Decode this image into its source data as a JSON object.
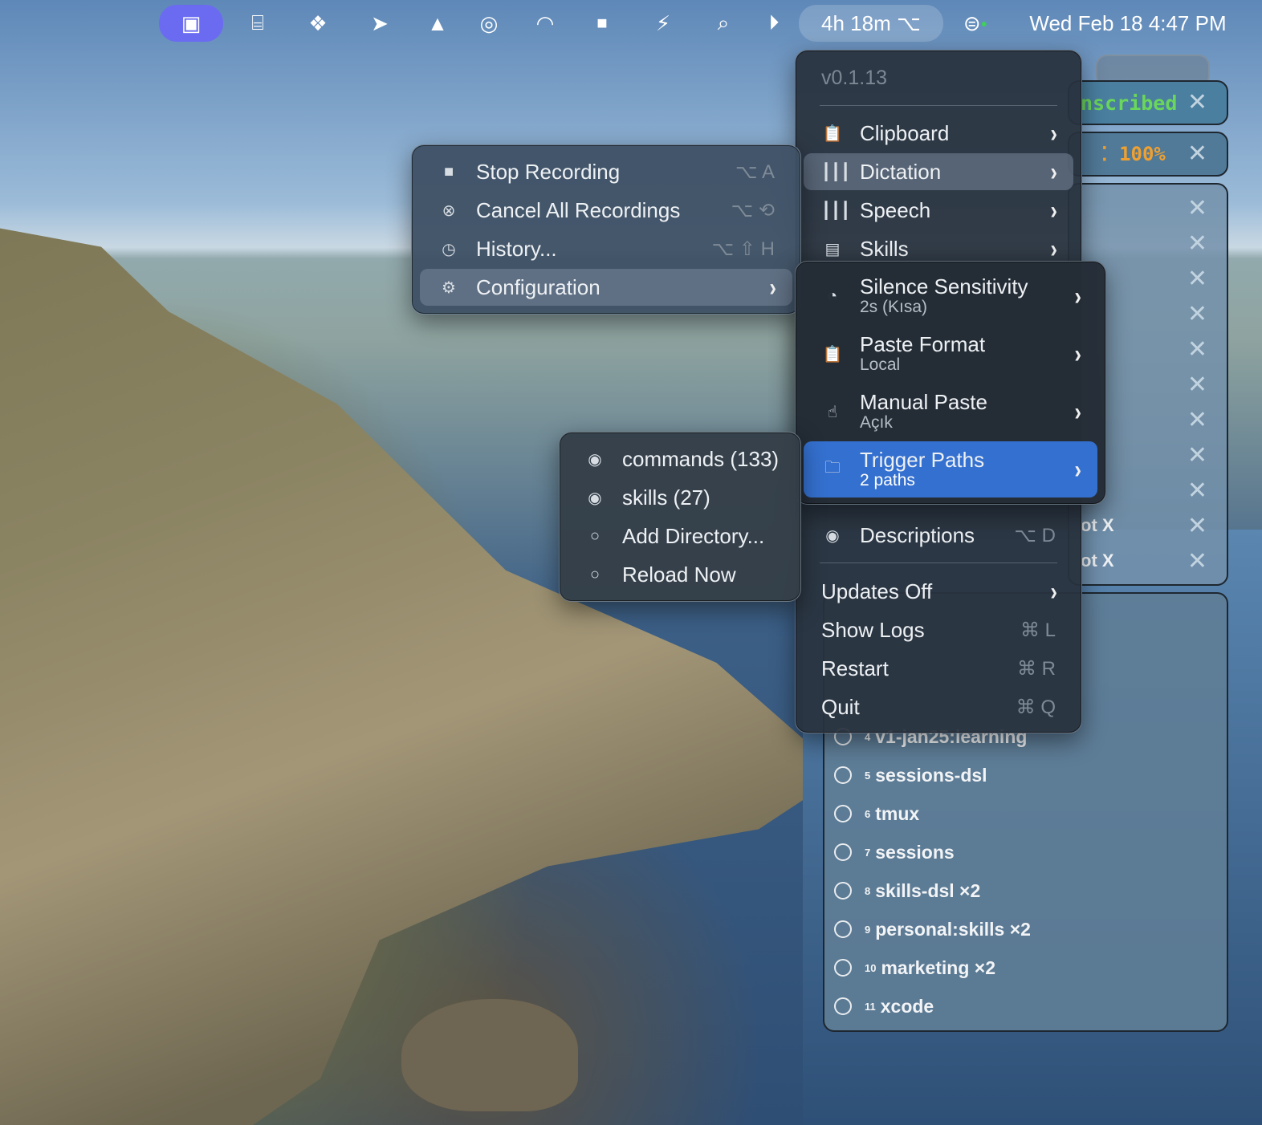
{
  "menubar": {
    "battery_time": "4h 18m",
    "datetime": "Wed Feb 18  4:47 PM",
    "icons": [
      "screen-share-icon",
      "presentation-icon",
      "diamond-grid-icon",
      "location-arrow-icon",
      "drive-icon",
      "onepassword-icon",
      "wifi-icon",
      "stop-record-icon",
      "battery-charging-icon",
      "search-icon",
      "play-icon",
      "option-key-icon",
      "control-center-icon"
    ],
    "accent": "#6b6bf2"
  },
  "main_menu": {
    "version": "v0.1.13",
    "items": [
      {
        "label": "Clipboard",
        "icon": "clipboard-icon"
      },
      {
        "label": "Dictation",
        "icon": "waveform-icon"
      },
      {
        "label": "Speech",
        "icon": "waveform-icon"
      },
      {
        "label": "Skills",
        "icon": "book-icon"
      }
    ],
    "descriptions": {
      "label": "Descriptions",
      "shortcut": "⌥ D"
    },
    "updates": "Updates Off",
    "bottom": [
      {
        "label": "Show Logs",
        "shortcut": "⌘ L"
      },
      {
        "label": "Restart",
        "shortcut": "⌘ R"
      },
      {
        "label": "Quit",
        "shortcut": "⌘ Q"
      }
    ]
  },
  "dictation_menu": {
    "items": [
      {
        "label": "Stop Recording",
        "shortcut": "⌥ A",
        "icon": "stop-icon"
      },
      {
        "label": "Cancel All Recordings",
        "shortcut": "⌥ ⟲",
        "icon": "cancel-circle-icon"
      },
      {
        "label": "History...",
        "shortcut": "⌥ ⇧ H",
        "icon": "clock-icon"
      },
      {
        "label": "Configuration",
        "icon": "gear-icon"
      }
    ]
  },
  "config_menu": {
    "items": [
      {
        "title": "Silence Sensitivity",
        "subtitle": "2s (Kısa)",
        "icon": "timer-icon"
      },
      {
        "title": "Paste Format",
        "subtitle": "Local",
        "icon": "clipboard-icon"
      },
      {
        "title": "Manual Paste",
        "subtitle": "Açık",
        "icon": "hand-icon"
      },
      {
        "title": "Trigger Paths",
        "subtitle": "2 paths",
        "icon": "folder-icon"
      }
    ]
  },
  "trigger_menu": {
    "items": [
      {
        "label": "commands (133)",
        "checked": true
      },
      {
        "label": "skills (27)",
        "checked": true
      },
      {
        "label": "Add Directory...",
        "checked": false
      },
      {
        "label": "Reload Now",
        "checked": false
      }
    ]
  },
  "panels": {
    "transcribed": "nscribed",
    "progress": "100%",
    "status_color": "#6ad65a",
    "progress_color": "#f0a030",
    "list_fragments": [
      "ot X",
      "ot X"
    ],
    "list": [
      {
        "n": "4",
        "label": "v1-jan25:learning"
      },
      {
        "n": "5",
        "label": "sessions-dsl"
      },
      {
        "n": "6",
        "label": "tmux"
      },
      {
        "n": "7",
        "label": "sessions"
      },
      {
        "n": "8",
        "label": "skills-dsl  ×2"
      },
      {
        "n": "9",
        "label": "personal:skills  ×2"
      },
      {
        "n": "10",
        "label": "marketing  ×2"
      },
      {
        "n": "11",
        "label": "xcode"
      }
    ]
  }
}
